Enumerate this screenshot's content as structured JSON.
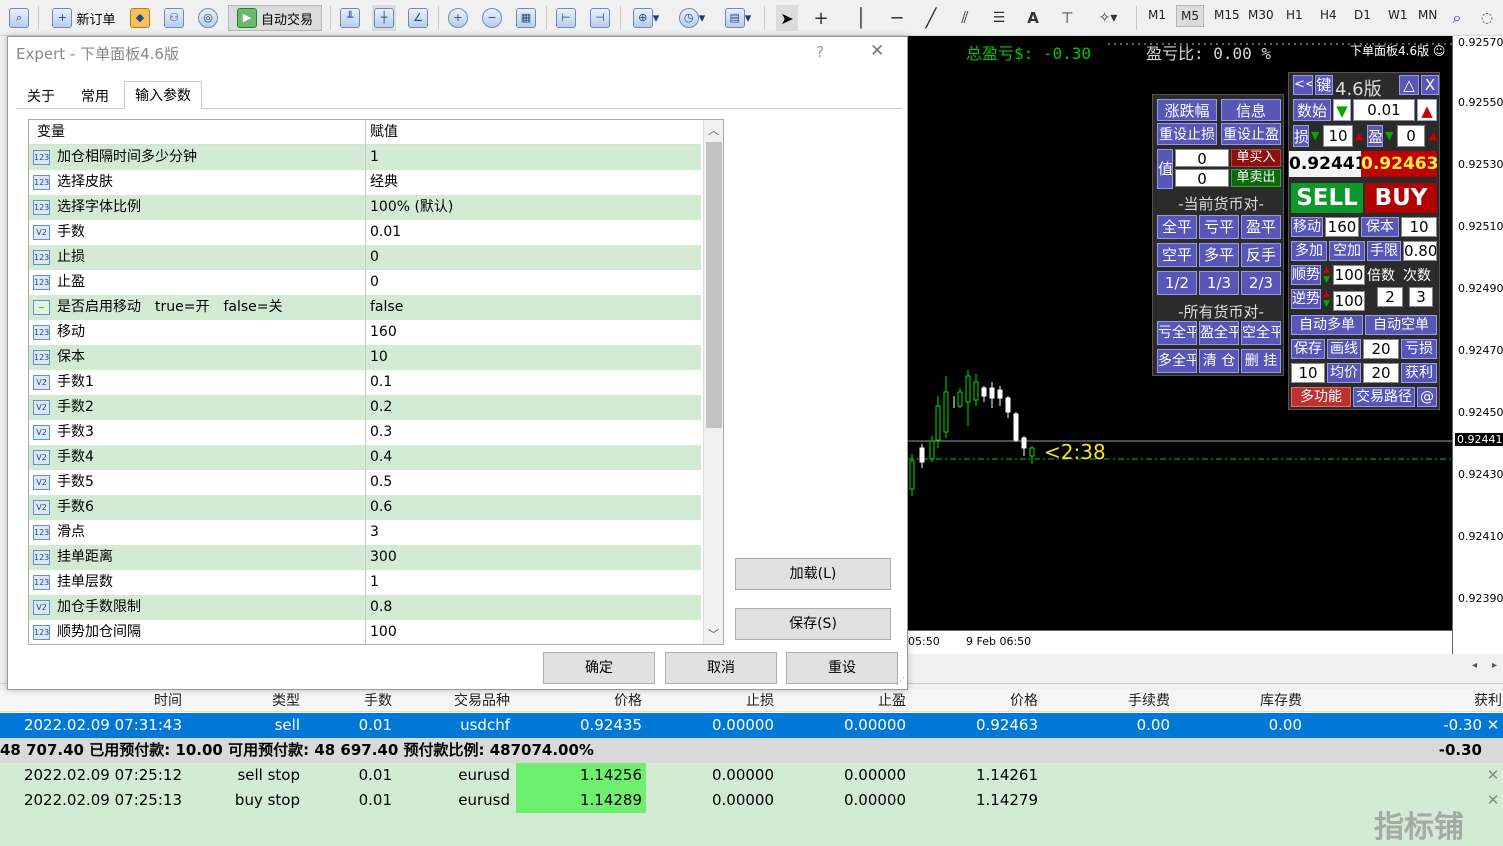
{
  "toolbar": {
    "new_order": "新订单",
    "auto_trade": "自动交易",
    "timeframes": [
      "M1",
      "M5",
      "M15",
      "M30",
      "H1",
      "H4",
      "D1",
      "W1",
      "MN"
    ]
  },
  "chart": {
    "total_pnl": "总盈亏$: -0.30",
    "pnl_ratio": "盈亏比: 0.00 %",
    "ea_name": "下单面板4.6版",
    "countdown": "<2:38",
    "price_labels": [
      "0.92570",
      "0.92550",
      "0.92530",
      "0.92510",
      "0.92490",
      "0.92470",
      "0.92450",
      "0.92441",
      "0.92430",
      "0.92410",
      "0.92390"
    ],
    "time_labels": [
      "05:50",
      "9 Feb 06:50"
    ]
  },
  "panel": {
    "top": {
      "back": "<<",
      "key": "键",
      "ver": "4.6版",
      "min": "△",
      "close": "X"
    },
    "lots_label": "数始",
    "lots": "0.01",
    "sl_label": "损",
    "sl": "10",
    "tp_label": "盈",
    "tp": "0",
    "bid": "0.92441",
    "ask": "0.92463",
    "sell": "SELL",
    "buy": "BUY",
    "trail_label": "移动",
    "trail": "160",
    "be_label": "保本",
    "be": "10",
    "add_long": "多加",
    "add_short": "空加",
    "lot_limit_label": "手限",
    "lot_limit": "0.80",
    "trend_label": "顺势",
    "trend": "100",
    "mult_label": "倍数",
    "count_label": "次数",
    "counter_label": "逆势",
    "counter": "100",
    "mult": "2",
    "count": "3",
    "auto_long": "自动多单",
    "auto_short": "自动空单",
    "save": "保存",
    "draw": "画线",
    "loss_val": "20",
    "loss_lbl": "亏损",
    "v10": "10",
    "avg": "均价",
    "profit_val": "20",
    "profit_lbl": "获利",
    "multi_func": "多功能",
    "trade_path": "交易路径",
    "at": "@"
  },
  "left_panel": {
    "chg": "涨跌幅",
    "info": "信息",
    "reset_sl": "重设止损",
    "reset_tp": "重设止盈",
    "val_label": "值",
    "v1": "0",
    "v2": "0",
    "buy_stop": "单买入",
    "sell_stop": "单卖出",
    "cur_pair": "-当前货币对-",
    "close_all": "全平",
    "close_loss": "亏平",
    "close_profit": "盈平",
    "close_short": "空平",
    "close_long": "多平",
    "reverse": "反手",
    "half": "1/2",
    "third": "1/3",
    "two_third": "2/3",
    "all_pairs": "-所有货币对-",
    "a1": "亏全平",
    "a2": "盈全平",
    "a3": "空全平",
    "a4": "多全平",
    "a5": "清 仓",
    "a6": "删 挂"
  },
  "dialog": {
    "title": "Expert - 下单面板4.6版",
    "help": "?",
    "close": "✕",
    "tabs": [
      "关于",
      "常用",
      "输入参数"
    ],
    "col_var": "变量",
    "col_val": "赋值",
    "params": [
      {
        "icon": "123",
        "name": "加仓相隔时间多少分钟",
        "value": "1"
      },
      {
        "icon": "123",
        "name": "选择皮肤",
        "value": "经典"
      },
      {
        "icon": "123",
        "name": "选择字体比例",
        "value": "100% (默认)"
      },
      {
        "icon": "V2",
        "name": "手数",
        "value": "0.01"
      },
      {
        "icon": "123",
        "name": "止损",
        "value": "0"
      },
      {
        "icon": "123",
        "name": "止盈",
        "value": "0"
      },
      {
        "icon": "~",
        "name": "是否启用移动　true=开　false=关",
        "value": "false"
      },
      {
        "icon": "123",
        "name": "移动",
        "value": "160"
      },
      {
        "icon": "123",
        "name": "保本",
        "value": "10"
      },
      {
        "icon": "V2",
        "name": "手数1",
        "value": "0.1"
      },
      {
        "icon": "V2",
        "name": "手数2",
        "value": "0.2"
      },
      {
        "icon": "V2",
        "name": "手数3",
        "value": "0.3"
      },
      {
        "icon": "V2",
        "name": "手数4",
        "value": "0.4"
      },
      {
        "icon": "V2",
        "name": "手数5",
        "value": "0.5"
      },
      {
        "icon": "V2",
        "name": "手数6",
        "value": "0.6"
      },
      {
        "icon": "123",
        "name": "滑点",
        "value": "3"
      },
      {
        "icon": "123",
        "name": "挂单距离",
        "value": "300"
      },
      {
        "icon": "123",
        "name": "挂单层数",
        "value": "1"
      },
      {
        "icon": "V2",
        "name": "加仓手数限制",
        "value": "0.8"
      },
      {
        "icon": "123",
        "name": "顺势加仓间隔",
        "value": "100"
      }
    ],
    "load": "加载(L)",
    "save": "保存(S)",
    "ok": "确定",
    "cancel": "取消",
    "reset": "重设"
  },
  "terminal": {
    "headers": [
      "时间",
      "类型",
      "手数",
      "交易品种",
      "价格",
      "止损",
      "止盈",
      "价格",
      "手续费",
      "库存费",
      "获利"
    ],
    "row1": [
      "2022.02.09 07:31:43",
      "sell",
      "0.01",
      "usdchf",
      "0.92435",
      "0.00000",
      "0.00000",
      "0.92463",
      "0.00",
      "0.00",
      "-0.30"
    ],
    "summary": "48 707.40  已用预付款: 10.00  可用预付款: 48 697.40  预付款比例: 487074.00%",
    "summary_profit": "-0.30",
    "row2": [
      "2022.02.09 07:25:12",
      "sell stop",
      "0.01",
      "eurusd",
      "1.14256",
      "0.00000",
      "0.00000",
      "1.14261"
    ],
    "row3": [
      "2022.02.09 07:25:13",
      "buy stop",
      "0.01",
      "eurusd",
      "1.14289",
      "0.00000",
      "0.00000",
      "1.14279"
    ],
    "watermark": "指标铺"
  },
  "colors": {
    "panel_btn": "#5757b9",
    "sell": "#00cc00",
    "buy": "#c00000",
    "selected_row": "#0078d7",
    "row_green": "#d2ebd2",
    "price_green": "#6ef06e"
  }
}
